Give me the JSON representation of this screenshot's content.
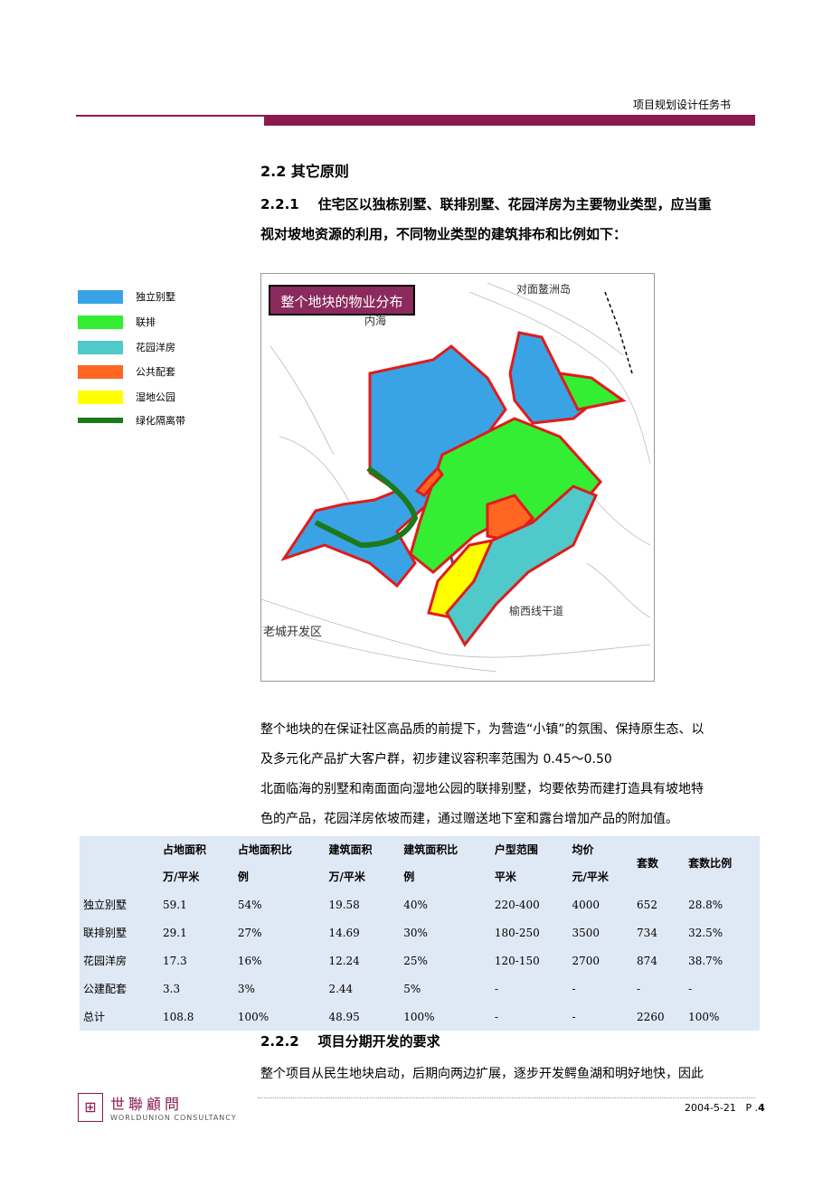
{
  "header": {
    "title": "项目规划设计任务书"
  },
  "section": {
    "heading": "2.2 其它原则",
    "sub1_num": "2.2.1",
    "sub1_text_line1": "住宅区以独栋别墅、联排别墅、花园洋房为主要物业类型，应当重",
    "sub1_text_line2": "视对坡地资源的利用，不同物业类型的建筑排布和比例如下："
  },
  "legend": [
    {
      "label": "独立别墅",
      "color": "#3aa3e6"
    },
    {
      "label": "联排",
      "color": "#33ee33"
    },
    {
      "label": "花园洋房",
      "color": "#4fc9c9"
    },
    {
      "label": "公共配套",
      "color": "#ff6622"
    },
    {
      "label": "湿地公园",
      "color": "#ffff00"
    },
    {
      "label": "绿化隔离带",
      "color": "#1c7a1c"
    }
  ],
  "map": {
    "title": "整个地块的物业分布",
    "labels": {
      "sea": "内海",
      "island": "对面鳌洲岛",
      "old_city": "老城开发区",
      "road": "榆西线干道"
    }
  },
  "paragraphs": {
    "p1_line1": "整个地块的在保证社区高品质的前提下，为营造“小镇”的氛围、保持原生态、以",
    "p1_line2": "及多元化产品扩大客户群，初步建议容积率范围为 0.45～0.50",
    "p2_line1": "北面临海的别墅和南面面向湿地公园的联排别墅，均要依势而建打造具有坡地特",
    "p2_line2": "色的产品，花园洋房依坡而建，通过赠送地下室和露台增加产品的附加值。"
  },
  "table": {
    "headers": [
      [
        "",
        ""
      ],
      [
        "占地面积",
        "万/平米"
      ],
      [
        "占地面积比",
        "例"
      ],
      [
        "建筑面积",
        "万/平米"
      ],
      [
        "建筑面积比",
        "例"
      ],
      [
        "户型范围",
        "平米"
      ],
      [
        "均价",
        "元/平米"
      ],
      [
        "套数",
        ""
      ],
      [
        "套数比例",
        ""
      ]
    ],
    "rows": [
      [
        "独立别墅",
        "59.1",
        "54%",
        "19.58",
        "40%",
        "220-400",
        "4000",
        "652",
        "28.8%"
      ],
      [
        "联排别墅",
        "29.1",
        "27%",
        "14.69",
        "30%",
        "180-250",
        "3500",
        "734",
        "32.5%"
      ],
      [
        "花园洋房",
        "17.3",
        "16%",
        "12.24",
        "25%",
        "120-150",
        "2700",
        "874",
        "38.7%"
      ],
      [
        "公建配套",
        "3.3",
        "3%",
        "2.44",
        "5%",
        "-",
        "-",
        "-",
        "-"
      ],
      [
        "总计",
        "108.8",
        "100%",
        "48.95",
        "100%",
        "-",
        "-",
        "2260",
        "100%"
      ]
    ]
  },
  "section2": {
    "num": "2.2.2",
    "title": "项目分期开发的要求",
    "text": "整个项目从民生地块启动，后期向两边扩展，逐步开发鳄鱼湖和明好地快，因此"
  },
  "footer": {
    "logo_cn": "世聯顧問",
    "logo_en": "WORLDUNION CONSULTANCY",
    "date": "2004-5-21",
    "page_prefix": "P .",
    "page_num": "4"
  }
}
